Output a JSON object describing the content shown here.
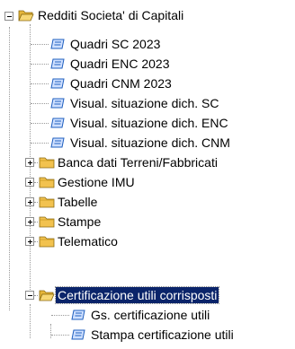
{
  "tree": {
    "root": {
      "label": "Redditi Societa' di Capitali",
      "icon": "open-folder-icon",
      "expanded": true
    },
    "children": [
      {
        "label": "Quadri SC  2023",
        "icon": "form-icon"
      },
      {
        "label": "Quadri ENC 2023",
        "icon": "form-icon"
      },
      {
        "label": "Quadri CNM 2023",
        "icon": "form-icon"
      },
      {
        "label": "Visual. situazione dich. SC",
        "icon": "form-icon"
      },
      {
        "label": "Visual. situazione dich. ENC",
        "icon": "form-icon"
      },
      {
        "label": "Visual. situazione dich. CNM",
        "icon": "form-icon"
      },
      {
        "label": "Banca dati Terreni/Fabbricati",
        "icon": "closed-folder-icon",
        "expanded": false
      },
      {
        "label": "Gestione IMU",
        "icon": "closed-folder-icon",
        "expanded": false
      },
      {
        "label": "Tabelle",
        "icon": "closed-folder-icon",
        "expanded": false
      },
      {
        "label": "Stampe",
        "icon": "closed-folder-icon",
        "expanded": false
      },
      {
        "label": "Telematico",
        "icon": "closed-folder-icon",
        "expanded": false
      },
      {
        "label": "Certificazione utili corrisposti",
        "icon": "open-folder-icon",
        "expanded": true,
        "selected": true,
        "children": [
          {
            "label": "Gs. certificazione utili",
            "icon": "form-icon"
          },
          {
            "label": "Stampa certificazione utili",
            "icon": "form-icon"
          }
        ]
      }
    ]
  },
  "colors": {
    "selection_bg": "#0a246a",
    "selection_fg": "#ffffff",
    "folder": "#f2c24f",
    "form_icon": "#1f5fbf"
  }
}
